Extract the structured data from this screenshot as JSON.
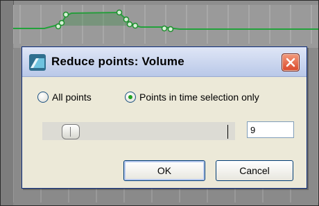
{
  "dialog": {
    "title": "Reduce points: Volume",
    "options": [
      {
        "label": "All points",
        "checked": false
      },
      {
        "label": "Points in time selection only",
        "checked": true
      }
    ],
    "slider": {
      "level": 0.1
    },
    "points_value": "9",
    "ok_label": "OK",
    "cancel_label": "Cancel"
  },
  "colors": {
    "envelope_line": "#22a23a",
    "titlebar": "#c6d3ef",
    "close_button": "#e0553a",
    "dialog_bg": "#ece9d8"
  },
  "icons": {
    "app": "reaper-envelope-icon",
    "close": "close-icon"
  }
}
